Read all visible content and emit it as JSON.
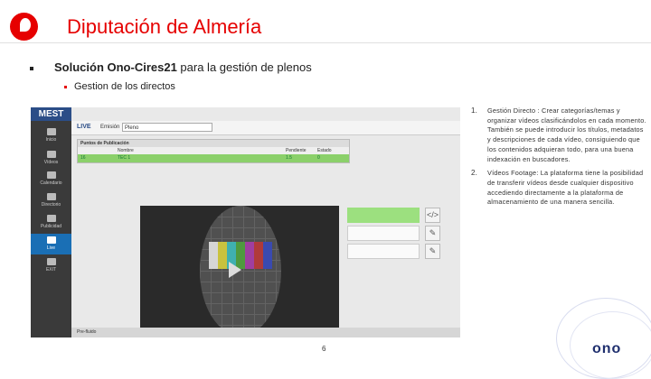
{
  "header": {
    "title": "Diputación de Almería"
  },
  "bullets": {
    "level1_bold": "Solución Ono-Cires21",
    "level1_rest": " para la gestión de plenos",
    "level2": "Gestion de los directos"
  },
  "app": {
    "brand": "MEST",
    "nav": [
      "Inicio",
      "Vídeos",
      "Calendario",
      "Directorio",
      "Publicidad",
      "Live",
      "EXIT"
    ],
    "topbar_live": "LIVE",
    "topbar_label": "Emisión",
    "topbar_value": "Pleno",
    "table_header": "Puntos de Publicación",
    "columns": [
      "Nombre",
      "Pendiente",
      "Estado"
    ],
    "row": {
      "id": "16",
      "name": "TEC 1",
      "pending": "1.5",
      "status": "0"
    },
    "footer": "Pre-fluido"
  },
  "list": [
    {
      "num": "1.",
      "text": "Gestión Directo : Crear categorías/temas y organizar vídeos clasificándolos en cada momento. También se puede introducir los títulos, metadatos y descripciones de cada vídeo, consiguiendo que los contenidos adquieran todo, para una buena indexación en buscadores."
    },
    {
      "num": "2.",
      "text": "Vídeos Footage: La plataforma tiene la posibilidad de transferir vídeos desde cualquier dispositivo accediendo directamente a la plataforma de almacenamiento de una manera sencilla."
    }
  ],
  "footer": {
    "page_number": "6",
    "brand": "ono"
  },
  "colors": {
    "accent": "#e60000",
    "highlight": "#8bd06a",
    "ono_blue": "#1f2f6e"
  }
}
